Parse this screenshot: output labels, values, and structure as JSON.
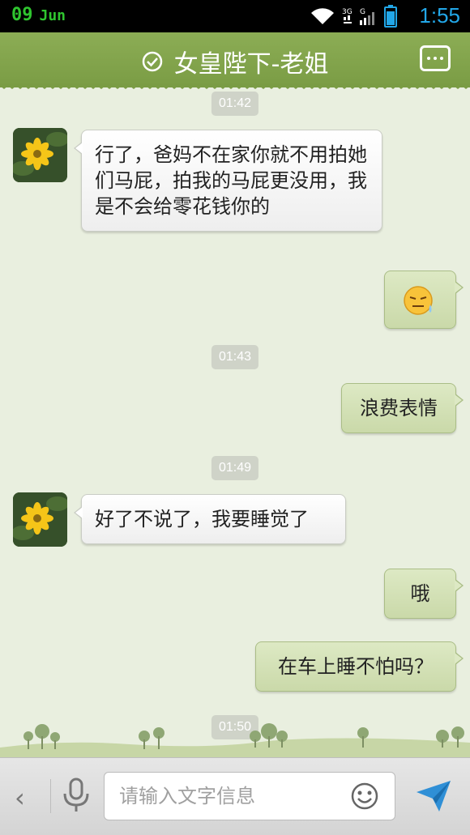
{
  "status_bar": {
    "day": "09",
    "month": "Jun",
    "network": "3G",
    "time": "1:55",
    "icons": [
      "wifi-icon",
      "3g-signal-icon",
      "battery-icon"
    ]
  },
  "header": {
    "title": "女皇陛下-老姐",
    "menu_icon": "more-icon",
    "status_icon": "check-circle-icon"
  },
  "colors": {
    "header_green": "#8cad55",
    "background": "#e9efdf",
    "outgoing_bubble": "#cad9a9",
    "incoming_bubble": "#ffffff",
    "time_blue": "#22a7e8"
  },
  "messages": {
    "ts1": "01:42",
    "m1": "行了，爸妈不在家你就不用拍她们马屁，拍我的马屁更没用，我是不会给零花钱你的",
    "m2_emoji": "sweat-emoji",
    "ts2": "01:43",
    "m3": "浪费表情",
    "ts3": "01:49",
    "m4": "好了不说了，我要睡觉了",
    "m5": "哦",
    "m6": "在车上睡不怕吗？",
    "ts4": "01:50"
  },
  "input_bar": {
    "placeholder": "请输入文字信息"
  }
}
